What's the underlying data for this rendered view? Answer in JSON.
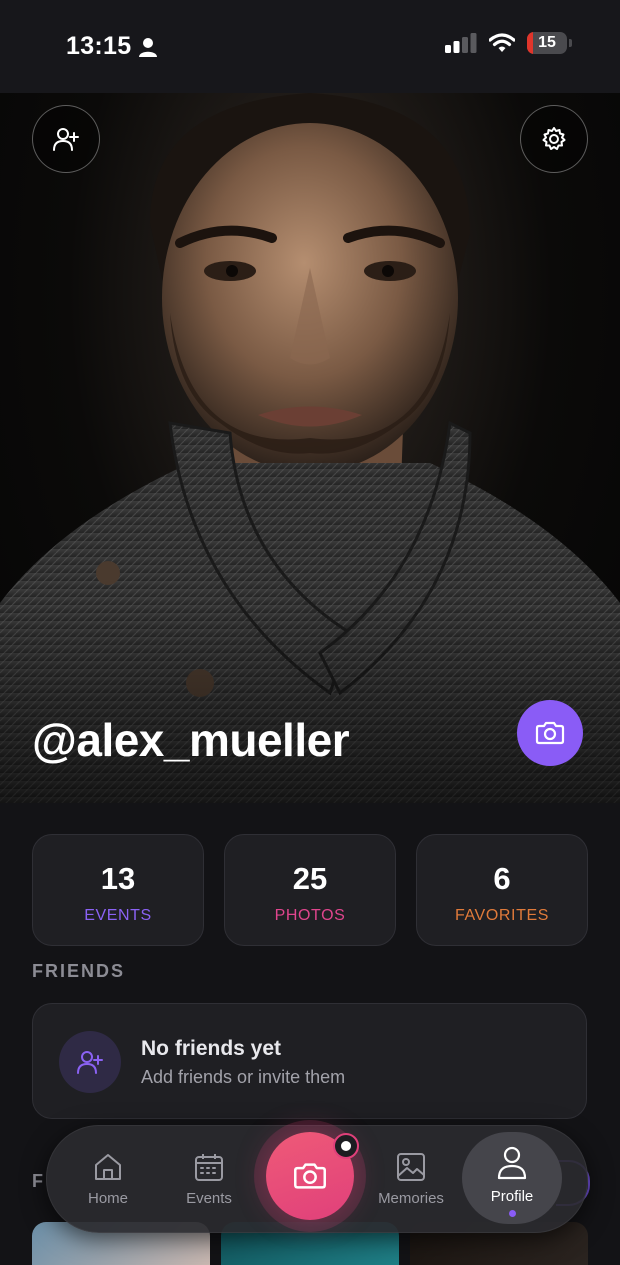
{
  "status_bar": {
    "time": "13:15",
    "battery_level": "15",
    "battery_fraction": 0.15,
    "icons": [
      "person-icon",
      "signal-icon",
      "wifi-icon",
      "battery-icon"
    ]
  },
  "profile": {
    "username": "@alex_mueller",
    "icons": {
      "add_friend": "add-person-icon",
      "settings": "gear-icon",
      "change_photo": "camera-icon"
    }
  },
  "stats": [
    {
      "value": "13",
      "label": "EVENTS",
      "color": "#8b62f4"
    },
    {
      "value": "25",
      "label": "PHOTOS",
      "color": "#e0458d"
    },
    {
      "value": "6",
      "label": "FAVORITES",
      "color": "#e07a3a"
    }
  ],
  "friends": {
    "section_title": "FRIENDS",
    "empty_title": "No friends yet",
    "empty_subtitle": "Add friends or invite them"
  },
  "favorites": {
    "section_title_visible": "F"
  },
  "nav": {
    "items": [
      {
        "label": "Home",
        "icon": "home-icon"
      },
      {
        "label": "Events",
        "icon": "calendar-icon"
      },
      {
        "label": "Memories",
        "icon": "image-icon"
      },
      {
        "label": "Profile",
        "icon": "person-icon",
        "active": true
      }
    ],
    "camera_icon": "camera-icon"
  },
  "colors": {
    "accent_purple": "#8a5cf6",
    "accent_pink": "#e0407a",
    "background": "#131316",
    "card": "#1f1f23"
  }
}
